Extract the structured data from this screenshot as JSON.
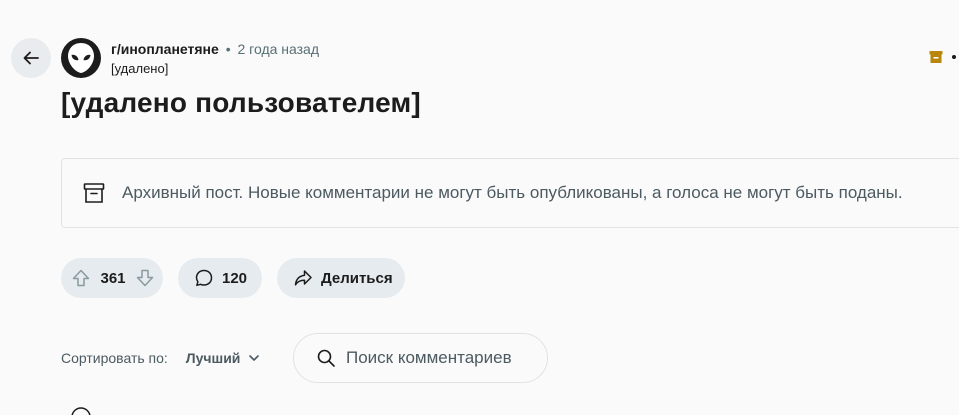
{
  "header": {
    "back_icon": "arrow-left-icon",
    "subreddit": "r/инопланетяне",
    "subreddit_display": "г/инопланетяне",
    "separator": "•",
    "time": "2 года назад",
    "author": "[удалено]",
    "archive_icon": "archive-box-icon",
    "more_icon": "more-options-icon"
  },
  "post": {
    "title": "[удалено пользователем]"
  },
  "archive_banner": {
    "icon": "archive-box-icon",
    "text": "Архивный пост. Новые комментарии не могут быть опубликованы, а голоса не могут быть поданы."
  },
  "actions": {
    "score": "361",
    "comments": "120",
    "share_label": "Делиться"
  },
  "sort": {
    "label": "Сортировать по:",
    "selected": "Лучший",
    "search_placeholder": "Поиск комментариев"
  },
  "colors": {
    "background": "#fafafa",
    "pill": "#e5ebee",
    "archive_accent": "#b8860b",
    "muted_text": "#4c5a61"
  }
}
